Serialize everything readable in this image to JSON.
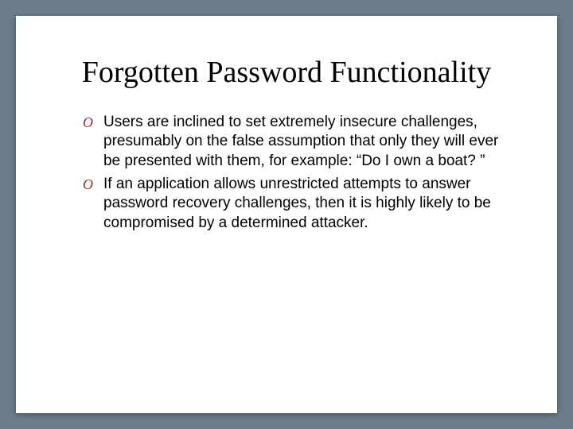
{
  "slide": {
    "title": "Forgotten Password Functionality",
    "bullets": [
      {
        "marker": "O",
        "text": "Users are inclined to set extremely insecure challenges, presumably on the false assumption that only they will ever be presented with them, for example: “Do I own a boat? ”"
      },
      {
        "marker": "O",
        "text": "If an application allows unrestricted attempts to answer password recovery challenges, then it is highly likely to be compromised by a determined attacker."
      }
    ]
  }
}
